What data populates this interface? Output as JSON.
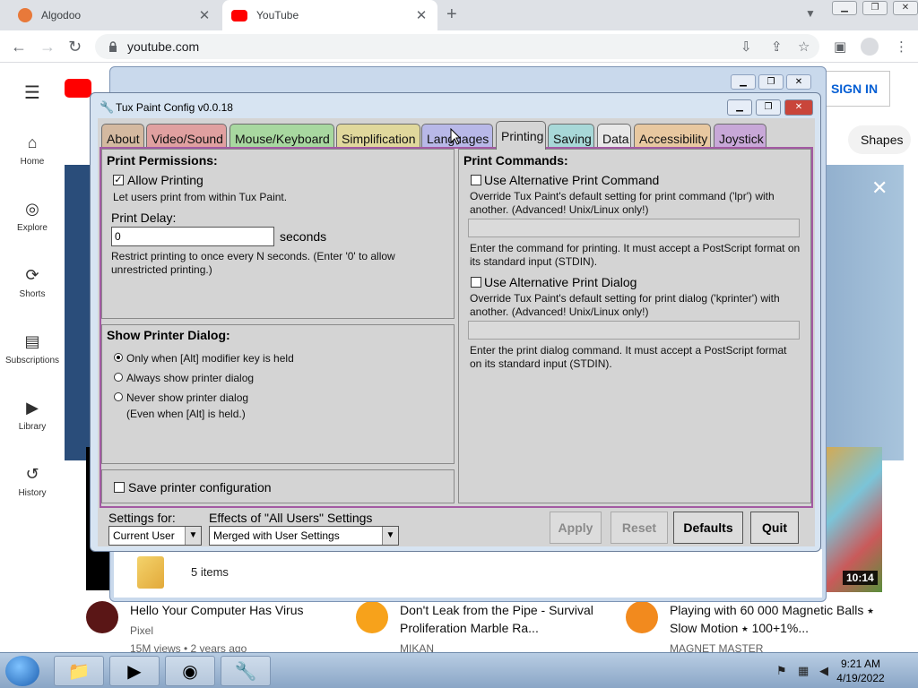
{
  "browser": {
    "tabs": [
      {
        "title": "Algodoo"
      },
      {
        "title": "YouTube"
      }
    ],
    "url": "youtube.com"
  },
  "youtube": {
    "sign_in": "SIGN IN",
    "chip": "Shapes",
    "nav": [
      {
        "label": "Home",
        "icon": "home-icon"
      },
      {
        "label": "Explore",
        "icon": "compass-icon"
      },
      {
        "label": "Shorts",
        "icon": "shorts-icon"
      },
      {
        "label": "Subscriptions",
        "icon": "subscriptions-icon"
      },
      {
        "label": "Library",
        "icon": "library-icon"
      },
      {
        "label": "History",
        "icon": "history-icon"
      }
    ],
    "duration": "10:14",
    "videos": [
      {
        "title": "Hello Your Computer Has Virus",
        "channel": "Pixel",
        "meta": "15M views • 2 years ago"
      },
      {
        "title": "Don't Leak from the Pipe - Survival Proliferation Marble Ra...",
        "channel": "MIKAN"
      },
      {
        "title": "Playing with 60 000 Magnetic Balls ⭑ Slow Motion ⭑ 100+1%...",
        "channel": "MAGNET MASTER"
      }
    ]
  },
  "explorer": {
    "items": "5 items"
  },
  "tux": {
    "title": "Tux Paint Config v0.0.18",
    "tabs": [
      "About",
      "Video/Sound",
      "Mouse/Keyboard",
      "Simplification",
      "Languages",
      "Printing",
      "Saving",
      "Data",
      "Accessibility",
      "Joystick"
    ],
    "active_tab": "Printing",
    "print_permissions": {
      "heading": "Print Permissions:",
      "allow_label": "Allow Printing",
      "allow_desc": "Let users print from within Tux Paint.",
      "delay_label": "Print Delay:",
      "delay_value": "0",
      "delay_unit": "seconds",
      "delay_desc": "Restrict printing to once every N seconds. (Enter '0' to allow unrestricted printing.)"
    },
    "printer_dialog": {
      "heading": "Show Printer Dialog:",
      "options": [
        "Only when [Alt] modifier key is held",
        "Always show printer dialog",
        "Never show printer dialog"
      ],
      "note": "(Even when [Alt] is held.)"
    },
    "save_config": "Save printer configuration",
    "print_commands": {
      "heading": "Print Commands:",
      "alt_cmd_label": "Use Alternative Print Command",
      "alt_cmd_desc": "Override Tux Paint's default setting for print command ('lpr') with another. (Advanced! Unix/Linux only!)",
      "alt_cmd_help": "Enter the command for printing. It must accept a PostScript format on its standard input (STDIN).",
      "alt_dlg_label": "Use Alternative Print Dialog",
      "alt_dlg_desc": "Override Tux Paint's default setting for print dialog ('kprinter') with another. (Advanced! Unix/Linux only!)",
      "alt_dlg_help": "Enter the print dialog command. It must accept a PostScript format on its standard input (STDIN)."
    },
    "settings_for_label": "Settings for:",
    "settings_for_value": "Current User",
    "effects_label": "Effects of \"All Users\" Settings",
    "effects_value": "Merged with User Settings",
    "buttons": {
      "apply": "Apply",
      "reset": "Reset",
      "defaults": "Defaults",
      "quit": "Quit"
    }
  },
  "taskbar": {
    "time": "9:21 AM",
    "date": "4/19/2022"
  },
  "colors": {
    "yt_red": "#ff0000",
    "link_blue": "#065fd4",
    "tab_colors": [
      "#d4b9a0",
      "#e0a0a0",
      "#a8d8a0",
      "#e0d89c",
      "#b8b8e8",
      "#d4d4d4",
      "#a8d8d8",
      "#e8e8e8",
      "#e8c8a0",
      "#c8a8d8"
    ]
  }
}
